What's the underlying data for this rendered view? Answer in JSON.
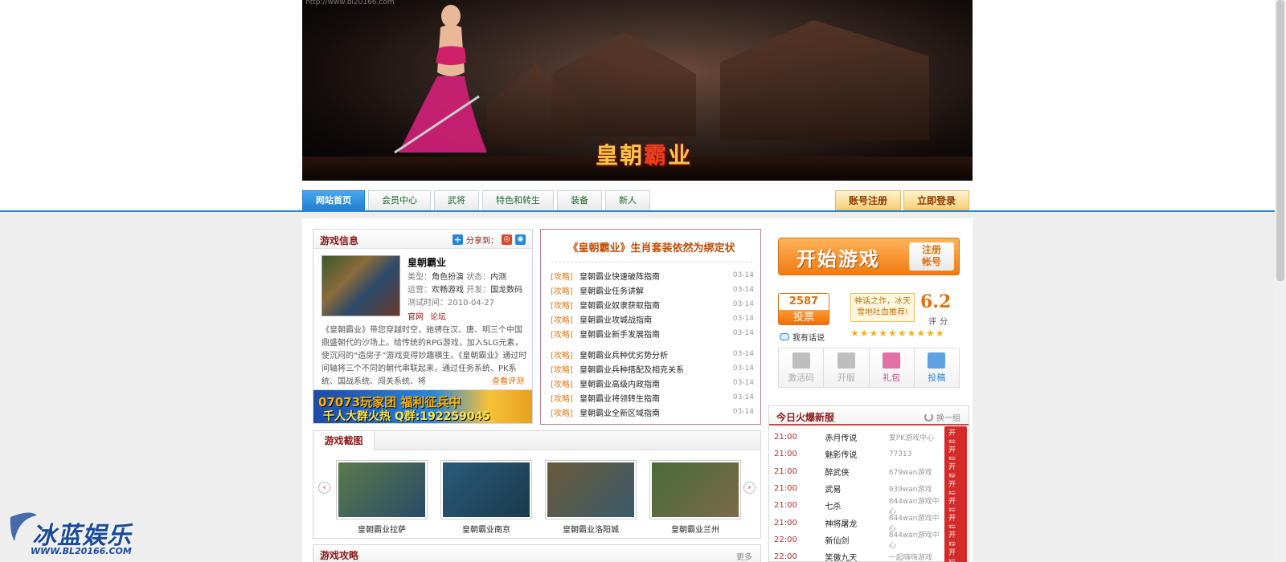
{
  "banner": {
    "url_text": "http://www.bl20166.com",
    "logo_a": "皇朝",
    "logo_b": "霸",
    "logo_c": "业"
  },
  "nav": {
    "tabs": [
      "网站首页",
      "会员中心",
      "武将",
      "特色和转生",
      "装备",
      "新人"
    ],
    "register": "账号注册",
    "login": "立即登录"
  },
  "game_info": {
    "title": "游戏信息",
    "share": "分享到：",
    "name": "皇朝霸业",
    "type_label": "类型：",
    "type": "角色扮演",
    "status_label": "状态：",
    "status": "内测",
    "operator_label": "运营：",
    "operator": "欢畅游戏",
    "developer_label": "开发：",
    "developer": "国龙数码",
    "test_label": "测试时间：",
    "test_date": "2010-04-27",
    "link_official": "官网",
    "link_forum": "论坛",
    "description": "《皇朝霸业》带您穿越时空，驰骋在汉、唐、明三个中国鼎盛朝代的沙场上。给传统的RPG游戏，加入SLG元素，使沉闷的“造房子”游戏变得妙趣横生。《皇朝霸业》通过时间轴将三个不同的朝代串联起来，通过任务系统、PK系统、国战系统、闯关系统、将",
    "more": "查看评测"
  },
  "ad": {
    "line1a": "07073玩家团",
    "line1b": "福利",
    "line1c": "征兵中",
    "line2a": "千人大群火热",
    "line2b": "Q群:192259045"
  },
  "guides": {
    "headline": "《皇朝霸业》生肖套装依然为绑定状",
    "items": [
      {
        "cat": "[攻略]",
        "text": "皇朝霸业快速破阵指南",
        "date": "03-14"
      },
      {
        "cat": "[攻略]",
        "text": "皇朝霸业任务讲解",
        "date": "03-14"
      },
      {
        "cat": "[攻略]",
        "text": "皇朝霸业奴隶获取指南",
        "date": "03-14"
      },
      {
        "cat": "[攻略]",
        "text": "皇朝霸业攻城战指南",
        "date": "03-14"
      },
      {
        "cat": "[攻略]",
        "text": "皇朝霸业新手发展指南",
        "date": "03-14"
      },
      {
        "cat": "[攻略]",
        "text": "皇朝霸业兵种优劣势分析",
        "date": "03-14"
      },
      {
        "cat": "[攻略]",
        "text": "皇朝霸业兵种搭配及相克关系",
        "date": "03-14"
      },
      {
        "cat": "[攻略]",
        "text": "皇朝霸业高级内政指南",
        "date": "03-14"
      },
      {
        "cat": "[攻略]",
        "text": "皇朝霸业将领转生指南",
        "date": "03-14"
      },
      {
        "cat": "[攻略]",
        "text": "皇朝霸业全新区域指南",
        "date": "03-14"
      }
    ]
  },
  "side": {
    "start": "开始游戏",
    "reg_a": "注册",
    "reg_b": "帐号",
    "votes": "2587",
    "vote_btn": "投票",
    "talk": "我有话说",
    "quote_a": "神话之作，冰天",
    "quote_b": "雪地吐血推荐!",
    "score": "6.2",
    "score_label": "评分",
    "stars": 10,
    "icons": [
      {
        "label": "激活码",
        "color": "#aaaaaa"
      },
      {
        "label": "开服",
        "color": "#aaaaaa"
      },
      {
        "label": "礼包",
        "color": "#d9408a"
      },
      {
        "label": "投稿",
        "color": "#2a86d8"
      }
    ]
  },
  "new_servers": {
    "title": "今日火爆新服",
    "swap": "换一组",
    "play": "开玩",
    "rows": [
      {
        "time": "21:00",
        "name": "赤月传说",
        "op": "爱PK游戏中心"
      },
      {
        "time": "21:00",
        "name": "魅影传说",
        "op": "77313"
      },
      {
        "time": "21:00",
        "name": "醉武侠",
        "op": "679wan游戏"
      },
      {
        "time": "21:00",
        "name": "武易",
        "op": "939wan游戏"
      },
      {
        "time": "21:00",
        "name": "七杀",
        "op": "844wan游戏中心"
      },
      {
        "time": "21:00",
        "name": "神将屠龙",
        "op": "844wan游戏中心"
      },
      {
        "time": "22:00",
        "name": "新仙剑",
        "op": "844wan游戏中心"
      },
      {
        "time": "22:00",
        "name": "笑傲九天",
        "op": "一起嗨嗨游戏"
      }
    ]
  },
  "screens": {
    "title": "游戏截图",
    "items": [
      {
        "caption": "皇朝霸业拉萨",
        "c1": "#5a7a4a",
        "c2": "#2a4a6a"
      },
      {
        "caption": "皇朝霸业南京",
        "c1": "#2a5a7a",
        "c2": "#1a3a4a"
      },
      {
        "caption": "皇朝霸业洛阳城",
        "c1": "#6a5a3a",
        "c2": "#3a5a6a"
      },
      {
        "caption": "皇朝霸业兰州",
        "c1": "#4a6a3a",
        "c2": "#7a6a4a"
      }
    ]
  },
  "guides_section": {
    "title": "游戏攻略",
    "more": "更多"
  },
  "watermark": {
    "text": "冰蓝娱乐",
    "url": "WWW.BL20166.COM"
  }
}
